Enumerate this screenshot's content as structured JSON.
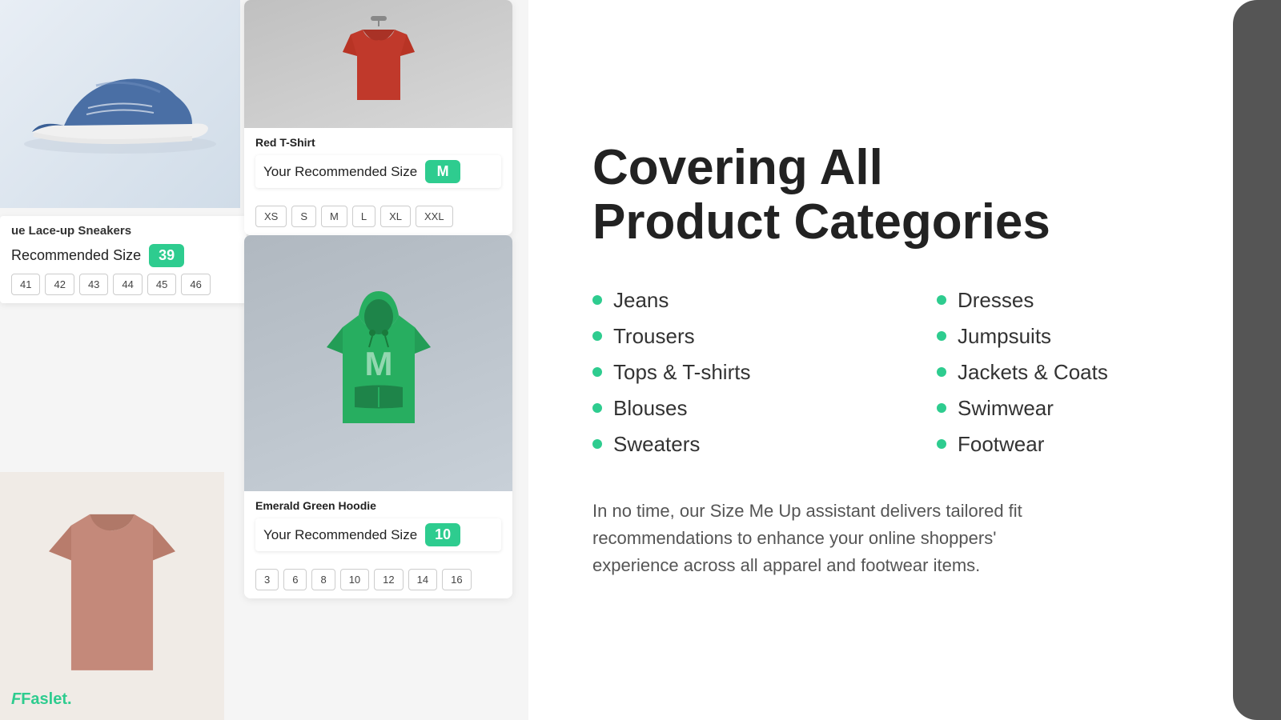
{
  "leftPanel": {
    "shoeAlt": "Blue Lace-up Sneakers",
    "sneakerCard": {
      "title": "ue Lace-up Sneakers",
      "recommendedLabel": "Recommended Size",
      "recommendedSize": "39",
      "sizes": [
        "41",
        "42",
        "43",
        "44",
        "45",
        "46"
      ]
    },
    "redShirt": {
      "name": "Red T-Shirt",
      "recommendedLabel": "Your Recommended Size",
      "recommendedSize": "M",
      "sizes": [
        "XS",
        "S",
        "M",
        "L",
        "XL",
        "XXL"
      ]
    },
    "hoodie": {
      "name": "Emerald Green Hoodie",
      "recommendedLabel": "Your Recommended Size",
      "recommendedSize": "10",
      "sizes": [
        "3",
        "6",
        "8",
        "10",
        "12",
        "14",
        "16"
      ]
    },
    "logo": "Faslet."
  },
  "rightPanel": {
    "heading1": "Covering All",
    "heading2": "Product Categories",
    "categories": [
      {
        "col": 1,
        "name": "Jeans"
      },
      {
        "col": 2,
        "name": "Dresses"
      },
      {
        "col": 1,
        "name": "Trousers"
      },
      {
        "col": 2,
        "name": "Jumpsuits"
      },
      {
        "col": 1,
        "name": "Tops & T-shirts"
      },
      {
        "col": 2,
        "name": "Jackets & Coats"
      },
      {
        "col": 1,
        "name": "Blouses"
      },
      {
        "col": 2,
        "name": "Swimwear"
      },
      {
        "col": 1,
        "name": "Sweaters"
      },
      {
        "col": 2,
        "name": "Footwear"
      }
    ],
    "description": "In no time, our Size Me Up assistant delivers tailored fit recommendations to enhance your online shoppers' experience across all apparel and footwear items."
  },
  "colors": {
    "accent": "#2ecc8f",
    "dark": "#222",
    "text": "#555"
  }
}
